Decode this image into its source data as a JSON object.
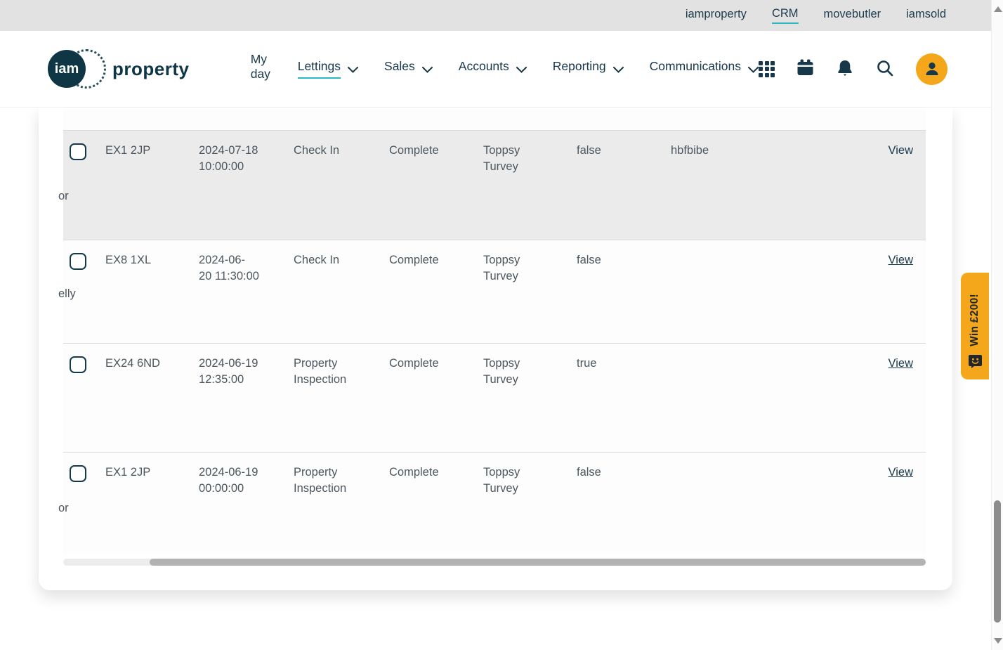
{
  "utility_bar": {
    "links": [
      {
        "label": "iamproperty",
        "active": false
      },
      {
        "label": "CRM",
        "active": true
      },
      {
        "label": "movebutler",
        "active": false
      },
      {
        "label": "iamsold",
        "active": false
      }
    ]
  },
  "brand": {
    "circle_text": "iam",
    "wordmark": "property"
  },
  "nav": {
    "items": [
      {
        "label": "My day",
        "has_dropdown": false,
        "active": false
      },
      {
        "label": "Lettings",
        "has_dropdown": true,
        "active": true
      },
      {
        "label": "Sales",
        "has_dropdown": true,
        "active": false
      },
      {
        "label": "Accounts",
        "has_dropdown": true,
        "active": false
      },
      {
        "label": "Reporting",
        "has_dropdown": true,
        "active": false
      },
      {
        "label": "Communications",
        "has_dropdown": true,
        "active": false
      }
    ]
  },
  "header_icons": [
    "apps-grid-icon",
    "calendar-icon",
    "notifications-bell-icon",
    "search-icon",
    "user-avatar"
  ],
  "table": {
    "rows": [
      {
        "fragment": "or",
        "postcode": "EX1 2JP",
        "datetime": "2024-07-18\n10:00:00",
        "type": "Check In",
        "status": "Complete",
        "person": "Toppsy\nTurvey",
        "flag": "false",
        "code": "hbfbibe",
        "action": "View",
        "highlighted": true
      },
      {
        "fragment": "elly",
        "postcode": "EX8 1XL",
        "datetime": "2024-06-\n20 11:30:00",
        "type": "Check In",
        "status": "Complete",
        "person": "Toppsy\nTurvey",
        "flag": "false",
        "code": "",
        "action": "View",
        "highlighted": false
      },
      {
        "fragment": "",
        "postcode": "EX24 6ND",
        "datetime": "2024-06-19\n12:35:00",
        "type": "Property\nInspection",
        "status": "Complete",
        "person": "Toppsy\nTurvey",
        "flag": "true",
        "code": "",
        "action": "View",
        "highlighted": false
      },
      {
        "fragment": "or",
        "postcode": "EX1 2JP",
        "datetime": "2024-06-19\n00:00:00",
        "type": "Property\nInspection",
        "status": "Complete",
        "person": "Toppsy\nTurvey",
        "flag": "false",
        "code": "",
        "action": "View",
        "highlighted": false
      }
    ]
  },
  "promo": {
    "label": "Win £200!",
    "icon": "chat-smile-icon",
    "color": "#f5a71c"
  },
  "colors": {
    "accent_teal": "#2ab7c4",
    "brand_dark": "#17384a",
    "avatar_orange": "#f5a71c",
    "utility_bar_bg": "#e2e2e2",
    "row_highlight": "#ebebeb",
    "table_text": "#4b565e",
    "border": "#d9d9d9"
  }
}
